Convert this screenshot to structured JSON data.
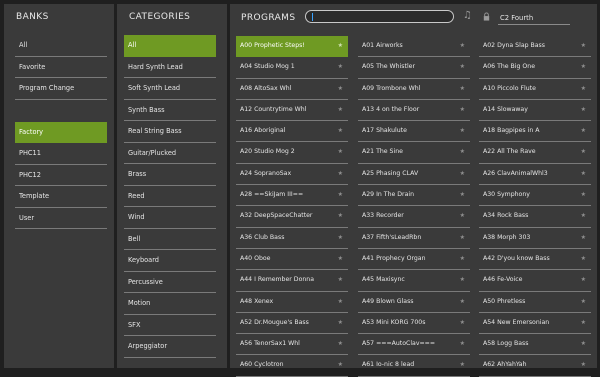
{
  "banks": {
    "title": "BANKS",
    "items": [
      "All",
      "Favorite",
      "Program Change",
      "",
      "Factory",
      "PHC11",
      "PHC12",
      "Template",
      "User"
    ],
    "selected_index": 4
  },
  "categories": {
    "title": "CATEGORIES",
    "items": [
      "All",
      "Hard Synth Lead",
      "Soft Synth Lead",
      "Synth Bass",
      "Real String Bass",
      "Guitar/Plucked",
      "Brass",
      "Reed",
      "Wind",
      "Bell",
      "Keyboard",
      "Percussive",
      "Motion",
      "SFX",
      "Arpeggiator"
    ],
    "selected_index": 0
  },
  "programs": {
    "title": "PROGRAMS",
    "search_value": "",
    "key_value": "C2  Fourth",
    "columns": [
      [
        "A00 Prophetic Steps!",
        "A04 Studio Mog 1",
        "A08 AltoSax Whl",
        "A12 Countrytime Whl",
        "A16 Aboriginal",
        "A20 Studio Mog 2",
        "A24 SopranoSax",
        "A28  ==SkiJam III==",
        "A32 DeepSpaceChatter",
        "A36 Club Bass",
        "A40 Oboe",
        "A44 I Remember Donna",
        "A48 Xenex",
        "A52 Dr.Mougue's Bass",
        "A56 TenorSax1 Whl",
        "A60 Cyclotron"
      ],
      [
        "A01 Airworks",
        "A05 The Whistler",
        "A09 Trombone Whl",
        "A13 4 on the Floor",
        "A17 Shakulute",
        "A21 The Sine",
        "A25 Phasing CLAV",
        "A29 In The Drain",
        "A33 Recorder",
        "A37 Fifth'sLeadRbn",
        "A41 Prophecy Organ",
        "A45 Maxisync",
        "A49 Blown Glass",
        "A53 Mini KORG 700s",
        "A57 ===AutoClav===",
        "A61 Io-nic 8 lead"
      ],
      [
        "A02 Dyna Slap Bass",
        "A06 The Big One",
        "A10 Piccolo Flute",
        "A14 Slowaway",
        "A18 Bagpipes in A",
        "A22 All The Rave",
        "A26 ClavAnimalWhl3",
        "A30 Symphony",
        "A34 Rock Bass",
        "A38 Morph 303",
        "A42 D'you know Bass",
        "A46 Fe-Voice",
        "A50 Phretless",
        "A54 New Emersonian",
        "A58 Logg Bass",
        "A62 AhYahYah"
      ]
    ],
    "selected": [
      0,
      0
    ],
    "star_glyph": "★"
  },
  "colors": {
    "selection": "#6f9a23",
    "panel": "#3a3a3a",
    "background": "#1f1f1f"
  },
  "icons": {
    "music": "music-note-icon",
    "lock": "lock-icon"
  }
}
